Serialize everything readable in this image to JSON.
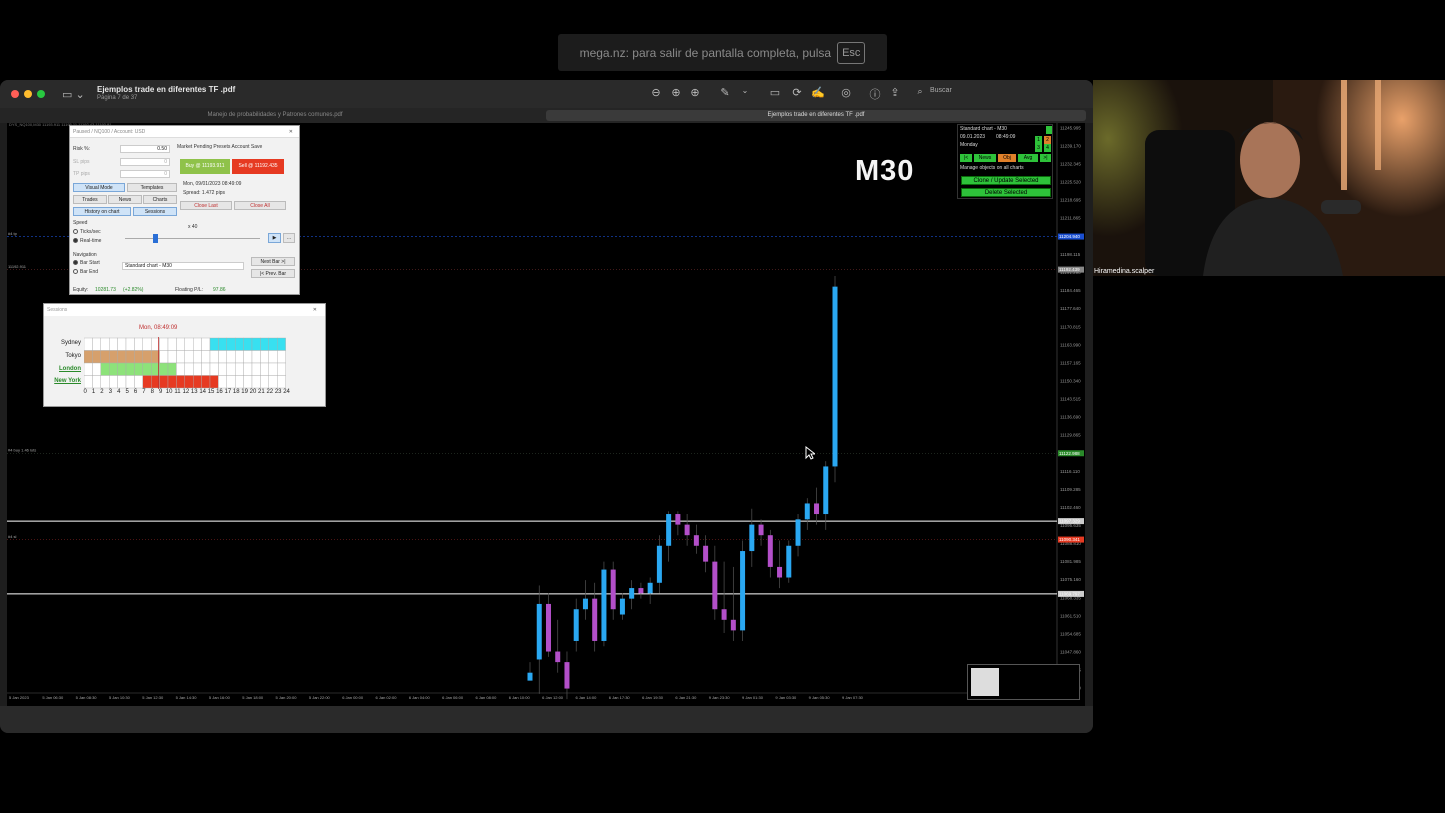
{
  "banner": {
    "text": "mega.nz: para salir de pantalla completa, pulsa",
    "key": "Esc"
  },
  "window": {
    "title": "Ejemplos trade en diferentes TF .pdf",
    "subtitle": "Página 7 de 37",
    "search_label": "Buscar",
    "tabs": [
      {
        "label": "Manejo de probabilidades y Patrones comunes.pdf",
        "active": false
      },
      {
        "label": "Ejemplos trade en diferentes TF .pdf",
        "active": true
      }
    ]
  },
  "chart": {
    "timeframe_label": "M30",
    "header_text": "DYS_NQ100,M30 11193.911 11195.11 11192.43 11193.91",
    "price_axis": [
      "11245.995",
      "11239.170",
      "11232.345",
      "11225.520",
      "11218.695",
      "11211.865",
      "11204.940",
      "11198.115",
      "11191.290",
      "11184.465",
      "11177.640",
      "11170.815",
      "11163.990",
      "11157.165",
      "11150.340",
      "11143.515",
      "11136.690",
      "11129.865",
      "11116.110",
      "11109.285",
      "11102.460",
      "11095.635",
      "11088.810",
      "11081.985",
      "11075.160",
      "11068.335",
      "11061.510",
      "11054.685",
      "11047.860",
      "11041.035",
      "11034.210"
    ],
    "price_highlights": [
      {
        "label": "11204.940",
        "color": "#1a4fd1"
      },
      {
        "label": "11192.439",
        "color": "#888888"
      },
      {
        "label": "11122.988",
        "color": "#2a8a2a"
      },
      {
        "label": "11097.329",
        "color": "#cccccc"
      },
      {
        "label": "11090.341",
        "color": "#e63a22"
      },
      {
        "label": "11069.797",
        "color": "#cccccc"
      }
    ],
    "time_axis": [
      "5 Jan 2023",
      "5 Jan 06:30",
      "5 Jan 08:30",
      "5 Jan 10:30",
      "5 Jan 12:30",
      "5 Jan 14:30",
      "5 Jan 16:00",
      "5 Jan 18:00",
      "5 Jan 20:00",
      "5 Jan 22:00",
      "6 Jan 00:00",
      "6 Jan 02:00",
      "6 Jan 04:00",
      "6 Jan 06:00",
      "6 Jan 08:00",
      "6 Jan 10:00",
      "6 Jan 12:00",
      "6 Jan 14:00",
      "6 Jan 17:30",
      "6 Jan 19:30",
      "6 Jan 21:30",
      "9 Jan 23:30",
      "9 Jan 01:30",
      "9 Jan 03:30",
      "9 Jan 05:30",
      "9 Jan 07:30"
    ],
    "line_labels": [
      "#4 tp",
      "11192.911",
      "#4 buy 1.46 lots",
      "#4 sl"
    ],
    "colors": {
      "bull": "#2aa8f2",
      "bear": "#b34fc9",
      "background": "#000000"
    }
  },
  "chart_data": {
    "type": "candlestick",
    "ylim": [
      11034.21,
      11245.995
    ],
    "candles": [
      {
        "o": 11037,
        "h": 11044,
        "c": 11040
      },
      {
        "o": 11045,
        "h": 11073,
        "l": 11032,
        "c": 11066
      },
      {
        "o": 11066,
        "h": 11070,
        "l": 11046,
        "c": 11048
      },
      {
        "o": 11048,
        "h": 11060,
        "l": 11040,
        "c": 11044
      },
      {
        "o": 11044,
        "h": 11048,
        "l": 11030,
        "c": 11034
      },
      {
        "o": 11052,
        "h": 11068,
        "l": 11048,
        "c": 11064
      },
      {
        "o": 11064,
        "h": 11075,
        "l": 11060,
        "c": 11068
      },
      {
        "o": 11068,
        "h": 11074,
        "l": 11048,
        "c": 11052
      },
      {
        "o": 11052,
        "h": 11082,
        "l": 11050,
        "c": 11079
      },
      {
        "o": 11079,
        "h": 11082,
        "l": 11060,
        "c": 11064
      },
      {
        "o": 11062,
        "h": 11070,
        "l": 11060,
        "c": 11068
      },
      {
        "o": 11068,
        "h": 11075,
        "l": 11064,
        "c": 11072
      },
      {
        "o": 11072,
        "h": 11074,
        "l": 11068,
        "c": 11070
      },
      {
        "o": 11070,
        "h": 11076,
        "l": 11066,
        "c": 11074
      },
      {
        "o": 11074,
        "h": 11092,
        "l": 11070,
        "c": 11088
      },
      {
        "o": 11088,
        "h": 11101,
        "l": 11082,
        "c": 11100
      },
      {
        "o": 11100,
        "h": 11101,
        "l": 11092,
        "c": 11096
      },
      {
        "o": 11096,
        "h": 11100,
        "l": 11088,
        "c": 11092
      },
      {
        "o": 11092,
        "h": 11096,
        "l": 11085,
        "c": 11088
      },
      {
        "o": 11088,
        "h": 11092,
        "l": 11078,
        "c": 11082
      },
      {
        "o": 11082,
        "h": 11088,
        "l": 11060,
        "c": 11064
      },
      {
        "o": 11064,
        "h": 11082,
        "l": 11055,
        "c": 11060
      },
      {
        "o": 11060,
        "h": 11080,
        "l": 11052,
        "c": 11056
      },
      {
        "o": 11056,
        "h": 11090,
        "l": 11052,
        "c": 11086
      },
      {
        "o": 11086,
        "h": 11102,
        "l": 11080,
        "c": 11096
      },
      {
        "o": 11096,
        "h": 11098,
        "l": 11088,
        "c": 11092
      },
      {
        "o": 11092,
        "h": 11094,
        "l": 11076,
        "c": 11080
      },
      {
        "o": 11080,
        "h": 11090,
        "l": 11072,
        "c": 11076
      },
      {
        "o": 11076,
        "h": 11090,
        "l": 11074,
        "c": 11088
      },
      {
        "o": 11088,
        "h": 11100,
        "l": 11084,
        "c": 11098
      },
      {
        "o": 11098,
        "h": 11106,
        "l": 11094,
        "c": 11104
      },
      {
        "o": 11104,
        "h": 11110,
        "l": 11096,
        "c": 11100
      },
      {
        "o": 11100,
        "h": 11120,
        "l": 11094,
        "c": 11118
      },
      {
        "o": 11118,
        "h": 11190,
        "l": 11112,
        "c": 11186
      }
    ]
  },
  "trade_panel": {
    "title": "Paused / NQ100 / Account: USD",
    "risk_label": "Risk %:",
    "risk_value": "0.50",
    "sl_label": "SL pips",
    "sl_value": "0",
    "tp_label": "TP pips",
    "tp_value": "0",
    "menu": "Market  Pending  Presets  Account  Save",
    "buy_label": "Buy @ 11193.911",
    "sell_label": "Sell @ 11192.435",
    "datetime": "Mon, 09/01/2023  08:49:09",
    "spread": "Spread: 1.472 pips",
    "close_last": "Close Last",
    "close_all": "Close All",
    "visual_mode": "Visual Mode",
    "templates": "Templates",
    "trades": "Trades",
    "news": "News",
    "charts": "Charts",
    "history_on_chart": "History on chart",
    "sessions": "Sessions",
    "speed_label": "Speed",
    "speed_value": "x 40",
    "ticks_label": "Ticks/sec",
    "realtime_label": "Real-time",
    "navigation_label": "Navigation",
    "bar_start": "Bar Start",
    "bar_end": "Bar End",
    "chart_select": "Standard chart - M30",
    "next_bar": "Next Bar >|",
    "prev_bar": "|< Prev. Bar",
    "equity_label": "Equity:",
    "equity_value": "10281.73",
    "equity_pct": "(+2.82%)",
    "floating_label": "Floating P/L:",
    "floating_value": "97.86"
  },
  "sessions_panel": {
    "title": "Sessions",
    "time": "Mon, 08:49:09",
    "rows": [
      {
        "label": "Sydney",
        "color": "#38e0f0",
        "start": 15,
        "end": 24,
        "highlight": false
      },
      {
        "label": "Tokyo",
        "color": "#d6a06c",
        "start": 0,
        "end": 9,
        "highlight": false
      },
      {
        "label": "London",
        "color": "#8de27a",
        "start": 2,
        "end": 11,
        "highlight": true
      },
      {
        "label": "New York",
        "color": "#e63a22",
        "start": 7,
        "end": 16,
        "highlight": true
      }
    ],
    "hours": [
      "0",
      "1",
      "2",
      "3",
      "4",
      "5",
      "6",
      "7",
      "8",
      "9",
      "10",
      "11",
      "12",
      "13",
      "14",
      "15",
      "16",
      "17",
      "18",
      "19",
      "20",
      "21",
      "22",
      "23",
      "24"
    ]
  },
  "control_panel": {
    "chart_name": "Standard chart - M30",
    "date": "09.01.2023",
    "time": "08:49:09",
    "day": "Monday",
    "prev": "|<",
    "news": "News",
    "obj": "Obj",
    "avg": "Avg",
    "next": ">|",
    "manage_text": "Manage objects on all charts",
    "clone_label": "Clone / Update Selected",
    "delete_label": "Delete Selected",
    "nums": [
      "1",
      "2",
      "3",
      "4"
    ]
  },
  "webcam": {
    "name": "Hiramedina.scalper"
  }
}
